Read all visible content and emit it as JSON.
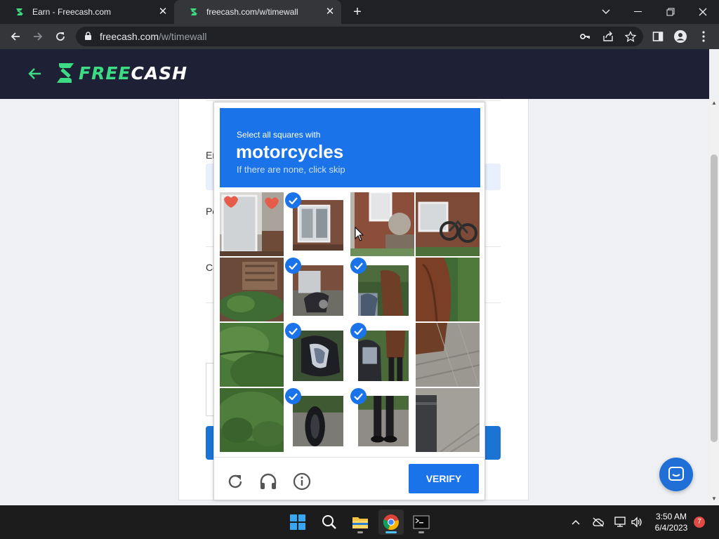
{
  "browser": {
    "tabs": [
      {
        "title": "Earn - Freecash.com",
        "active": false
      },
      {
        "title": "freecash.com/w/timewall",
        "active": true
      }
    ],
    "url_host": "freecash.com",
    "url_path": "/w/timewall"
  },
  "site": {
    "logo_text": "FREECASH",
    "accent": "#3ddc84",
    "header_bg": "#1e2135"
  },
  "card": {
    "labels": [
      "Er",
      "Pe",
      "Co"
    ]
  },
  "captcha": {
    "instruction": "Select all squares with",
    "target": "motorcycles",
    "hint": "If there are none, click skip",
    "verify_label": "VERIFY",
    "selected_tiles": [
      1,
      5,
      6,
      9,
      10,
      13,
      14
    ],
    "footer_icons": [
      "reload-icon",
      "audio-icon",
      "info-icon"
    ],
    "accent": "#1a73e8"
  },
  "taskbar": {
    "apps": [
      "windows-start-icon",
      "search-icon",
      "file-explorer-icon",
      "chrome-icon",
      "terminal-icon"
    ],
    "time": "3:50 AM",
    "date": "6/4/2023",
    "notifications": "7"
  }
}
